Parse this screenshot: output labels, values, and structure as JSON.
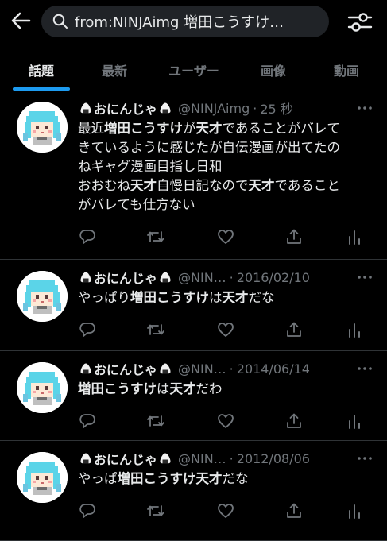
{
  "search": {
    "query": "from:NINJAimg 増田こうすけ…"
  },
  "tabs": [
    {
      "label": "話題",
      "active": true
    },
    {
      "label": "最新",
      "active": false
    },
    {
      "label": "ユーザー",
      "active": false
    },
    {
      "label": "画像",
      "active": false
    },
    {
      "label": "動画",
      "active": false
    }
  ],
  "colors": {
    "accent": "#1d9bf0",
    "muted": "#71767b",
    "text": "#e7e9ea",
    "divider": "#2f3336"
  },
  "tweets": [
    {
      "name": "おにんじゃ",
      "handle": "@NINJAimg",
      "time": "25 秒",
      "lines": [
        [
          [
            "最近",
            false
          ],
          [
            "増田こうすけ",
            true
          ],
          [
            "が",
            false
          ],
          [
            "天才",
            true
          ],
          [
            "であることがバレて",
            false
          ]
        ],
        [
          [
            "きているように感じたが自伝漫画が出てたの",
            false
          ]
        ],
        [
          [
            "ねギャグ漫画目指し日和",
            false
          ]
        ],
        [
          [
            "おおむね",
            false
          ],
          [
            "天才",
            true
          ],
          [
            "自慢日記なので",
            false
          ],
          [
            "天才",
            true
          ],
          [
            "であること",
            false
          ]
        ],
        [
          [
            "がバレても仕方ない",
            false
          ]
        ]
      ]
    },
    {
      "name": "おにんじゃ",
      "handle": "@NIN…",
      "time": "2016/02/10",
      "lines": [
        [
          [
            "やっぱり",
            false
          ],
          [
            "増田こうすけ",
            true
          ],
          [
            "は",
            false
          ],
          [
            "天才",
            true
          ],
          [
            "だな",
            false
          ]
        ]
      ]
    },
    {
      "name": "おにんじゃ",
      "handle": "@NIN…",
      "time": "2014/06/14",
      "lines": [
        [
          [
            "増田こうすけ",
            true
          ],
          [
            "は",
            false
          ],
          [
            "天才",
            true
          ],
          [
            "だわ",
            false
          ]
        ]
      ]
    },
    {
      "name": "おにんじゃ",
      "handle": "@NIN…",
      "time": "2012/08/06",
      "lines": [
        [
          [
            "やっぱ",
            false
          ],
          [
            "増田こうすけ",
            true
          ],
          [
            "天才",
            true
          ],
          [
            "だな",
            false
          ]
        ]
      ]
    }
  ]
}
